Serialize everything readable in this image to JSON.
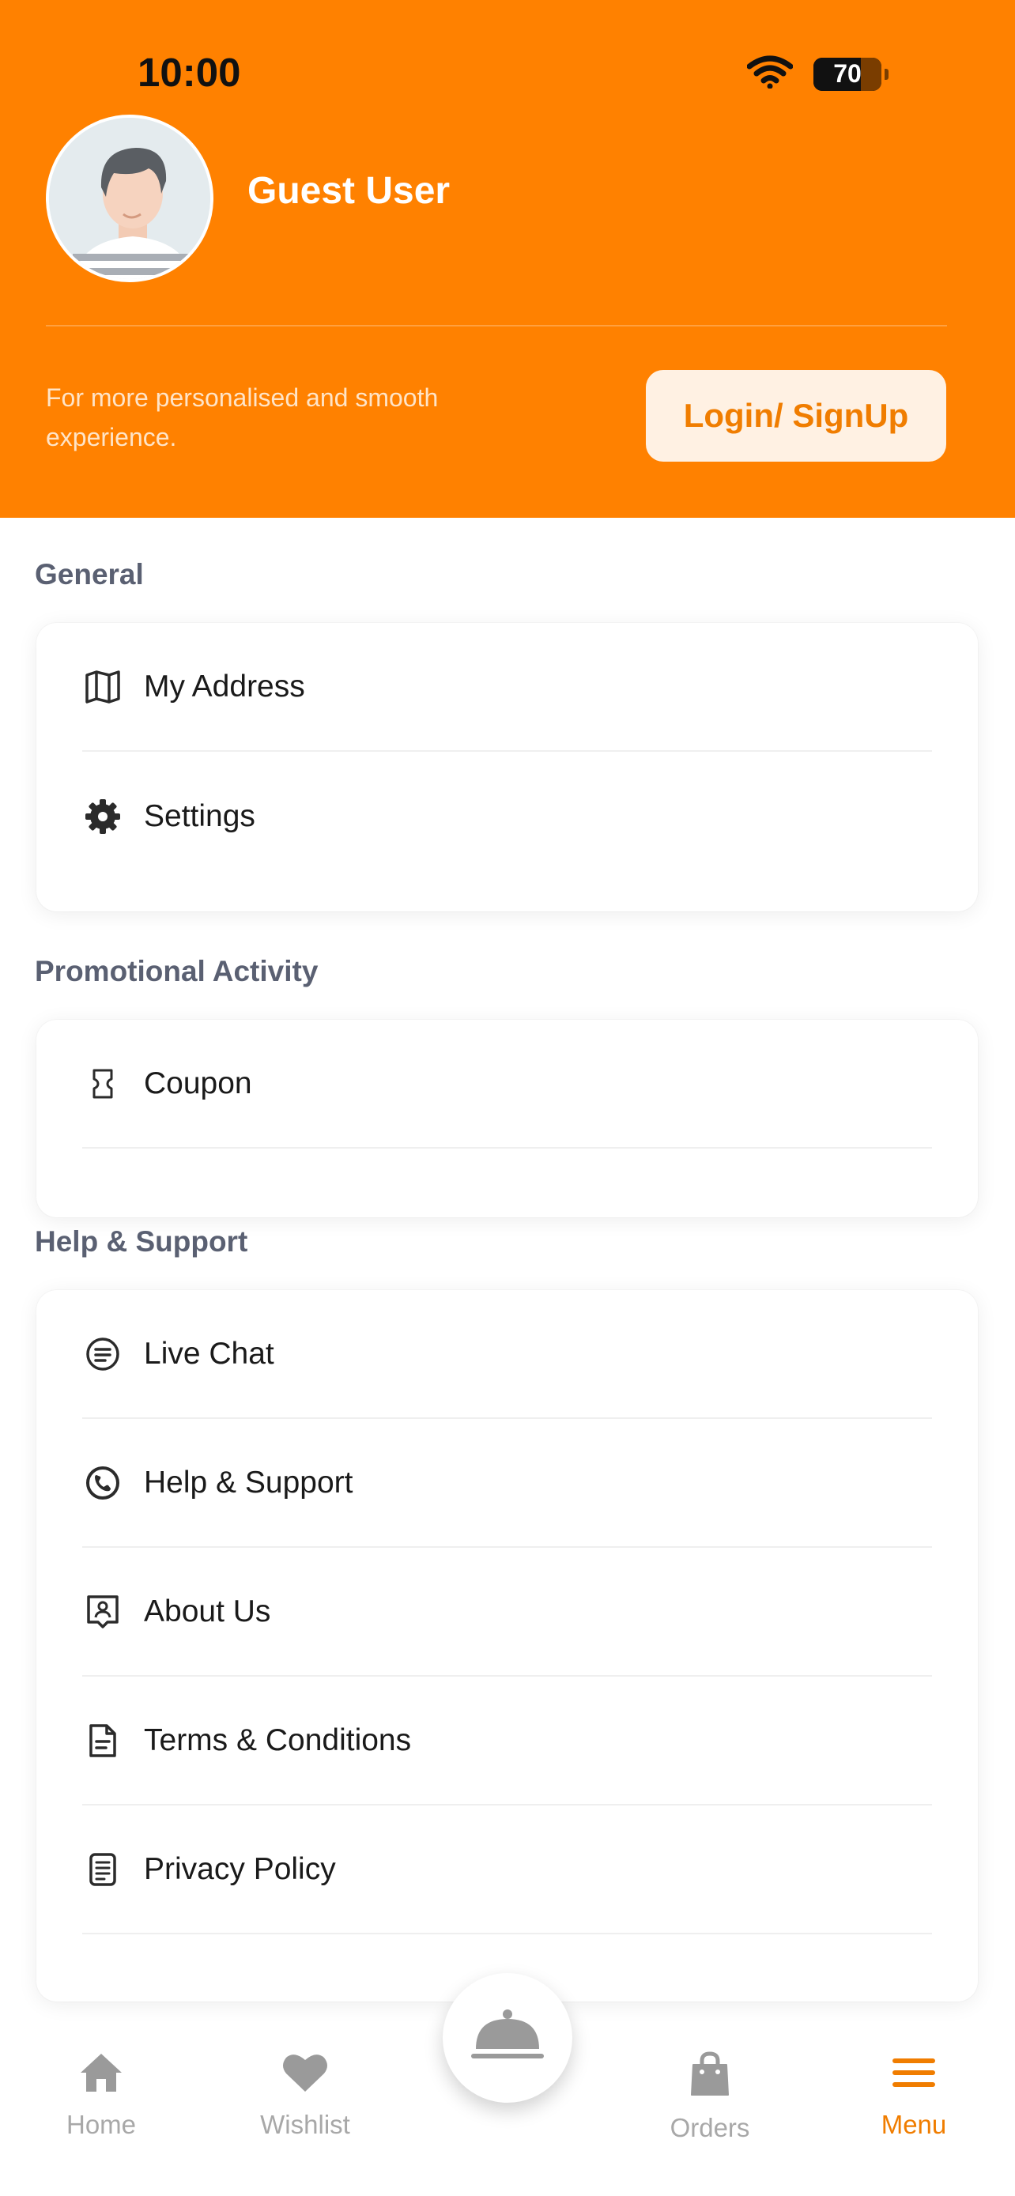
{
  "status_bar": {
    "time": "10:00",
    "battery": "70"
  },
  "profile": {
    "name": "Guest User",
    "prompt": "For more personalised and smooth experience.",
    "login_label": "Login/ SignUp"
  },
  "sections": {
    "general": {
      "title": "General",
      "items": [
        {
          "label": "My Address",
          "icon": "map-icon"
        },
        {
          "label": "Settings",
          "icon": "gear-icon"
        }
      ]
    },
    "promotional": {
      "title": "Promotional Activity",
      "items": [
        {
          "label": "Coupon",
          "icon": "coupon-icon"
        }
      ]
    },
    "help": {
      "title": "Help & Support",
      "items": [
        {
          "label": "Live Chat",
          "icon": "chat-icon"
        },
        {
          "label": "Help & Support",
          "icon": "phone-icon"
        },
        {
          "label": "About Us",
          "icon": "about-icon"
        },
        {
          "label": "Terms & Conditions",
          "icon": "document-icon"
        },
        {
          "label": "Privacy Policy",
          "icon": "policy-icon"
        }
      ]
    }
  },
  "bottom_nav": {
    "items": [
      {
        "label": "Home",
        "icon": "home-icon",
        "active": false
      },
      {
        "label": "Wishlist",
        "icon": "heart-icon",
        "active": false
      },
      {
        "label": "Orders",
        "icon": "shopping-bag-icon",
        "active": false
      },
      {
        "label": "Menu",
        "icon": "menu-icon",
        "active": true
      }
    ],
    "center_icon": "food-cloche-icon"
  },
  "colors": {
    "accent": "#FF8100",
    "accent_text": "#F07D00",
    "section_title": "#5A6072",
    "inactive_nav": "#A8A8A8"
  }
}
